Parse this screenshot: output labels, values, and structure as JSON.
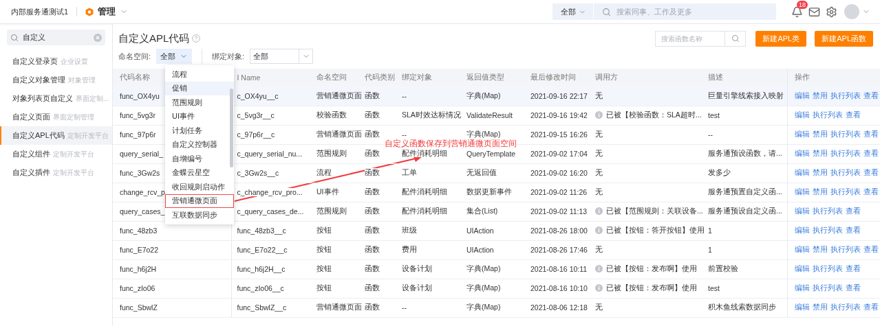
{
  "topbar": {
    "company": "内部服务通测试1",
    "app": "管理",
    "search": {
      "scope": "全部",
      "placeholder": "搜索同事、工作及更多"
    },
    "notifications": "18"
  },
  "sidebar": {
    "search": {
      "value": "自定义"
    },
    "items": [
      {
        "name": "自定义登录页",
        "section": "企业设置",
        "selected": false
      },
      {
        "name": "自定义对象管理",
        "section": "对象管理",
        "selected": false
      },
      {
        "name": "对象列表页自定义",
        "section": "界面定制...",
        "selected": false
      },
      {
        "name": "自定义页面",
        "section": "界面定制管理",
        "selected": false
      },
      {
        "name": "自定义APL代码",
        "section": "定制开发平台",
        "selected": true
      },
      {
        "name": "自定义组件",
        "section": "定制开发平台",
        "selected": false
      },
      {
        "name": "自定义插件",
        "section": "定制开发平台",
        "selected": false
      }
    ]
  },
  "page": {
    "title": "自定义APL代码",
    "search": {
      "placeholder": "搜索函数名称"
    },
    "buttons": [
      "新建APL类",
      "新建APL函数"
    ],
    "filters": [
      {
        "label": "命名空间:",
        "value": "全部",
        "open": true
      },
      {
        "label": "绑定对象:",
        "value": "全部",
        "open": false
      }
    ]
  },
  "dropdown": {
    "items": [
      {
        "label": "流程",
        "hovered": false,
        "outlined": false
      },
      {
        "label": "促销",
        "hovered": true,
        "outlined": false
      },
      {
        "label": "范围规则",
        "hovered": false,
        "outlined": false
      },
      {
        "label": "UI事件",
        "hovered": false,
        "outlined": false
      },
      {
        "label": "计划任务",
        "hovered": false,
        "outlined": false
      },
      {
        "label": "自定义控制器",
        "hovered": false,
        "outlined": false
      },
      {
        "label": "自增编号",
        "hovered": false,
        "outlined": false
      },
      {
        "label": "金蝶云星空",
        "hovered": false,
        "outlined": false
      },
      {
        "label": "收回规则启动作",
        "hovered": false,
        "outlined": false
      },
      {
        "label": "营销通微页面",
        "hovered": false,
        "outlined": true
      },
      {
        "label": "互联数据同步",
        "hovered": false,
        "outlined": false
      }
    ]
  },
  "annotation": {
    "text": "自定义函数保存到营销通微页面空间"
  },
  "table": {
    "columns": [
      "代码名称",
      "I Name",
      "命名空间",
      "代码类别",
      "绑定对象",
      "返回值类型",
      "最后修改时间",
      "调用方",
      "描述",
      "操作"
    ],
    "rows": [
      {
        "highlighted": true,
        "caller_used": false,
        "cells": [
          "func_OX4yu",
          "c_OX4yu__c",
          "营销通微页面",
          "函数",
          "--",
          "字典(Map)",
          "2021-09-16 22:17",
          "无",
          "巨量引擎线索接入映射"
        ],
        "actions": [
          "编辑",
          "禁用",
          "执行列表",
          "查看"
        ]
      },
      {
        "highlighted": false,
        "caller_used": true,
        "cells": [
          "func_5vg3r",
          "c_5vg3r__c",
          "校验函数",
          "函数",
          "SLA时效达标情况",
          "ValidateResult",
          "2021-09-16 19:42",
          "已被【校验函数：SLA超时...",
          "test"
        ],
        "actions": [
          "编辑",
          "执行列表",
          "查看"
        ]
      },
      {
        "highlighted": false,
        "caller_used": false,
        "cells": [
          "func_97p6r",
          "c_97p6r__c",
          "营销通微页面",
          "函数",
          "--",
          "字典(Map)",
          "2021-09-15 16:26",
          "无",
          "--"
        ],
        "actions": [
          "编辑",
          "禁用",
          "执行列表",
          "查看"
        ]
      },
      {
        "highlighted": false,
        "caller_used": false,
        "cells": [
          "query_serial_",
          "c_query_serial_nu...",
          "范围规则",
          "函数",
          "配件消耗明细",
          "QueryTemplate",
          "2021-09-02 17:04",
          "无",
          "服务通预设函数，请..."
        ],
        "actions": [
          "编辑",
          "禁用",
          "执行列表",
          "查看"
        ]
      },
      {
        "highlighted": false,
        "caller_used": false,
        "cells": [
          "func_3Gw2s",
          "c_3Gw2s__c",
          "流程",
          "函数",
          "工单",
          "无返回值",
          "2021-09-02 16:20",
          "无",
          "发多少"
        ],
        "actions": [
          "编辑",
          "禁用",
          "执行列表",
          "查看"
        ]
      },
      {
        "highlighted": false,
        "caller_used": false,
        "cells": [
          "change_rcv_p",
          "c_change_rcv_pro...",
          "UI事件",
          "函数",
          "配件消耗明细",
          "数据更新事件",
          "2021-09-02 11:26",
          "无",
          "服务通预置自定义函..."
        ],
        "actions": [
          "编辑",
          "禁用",
          "执行列表",
          "查看"
        ]
      },
      {
        "highlighted": false,
        "caller_used": true,
        "cells": [
          "query_cases_",
          "c_query_cases_de...",
          "范围规则",
          "函数",
          "配件消耗明细",
          "集合(List)",
          "2021-09-02 11:13",
          "已被【范围规则：关联设备...",
          "服务通预设自定义函..."
        ],
        "actions": [
          "编辑",
          "执行列表",
          "查看"
        ]
      },
      {
        "highlighted": false,
        "caller_used": true,
        "cells": [
          "func_48zb3",
          "func_48zb3__c",
          "按钮",
          "函数",
          "班级",
          "UIAction",
          "2021-08-26 18:00",
          "已被【按钮：答开按钮】使用",
          "1"
        ],
        "actions": [
          "编辑",
          "执行列表",
          "查看"
        ]
      },
      {
        "highlighted": false,
        "caller_used": false,
        "cells": [
          "func_E7o22",
          "func_E7o22__c",
          "按钮",
          "函数",
          "费用",
          "UIAction",
          "2021-08-26 17:46",
          "无",
          "1"
        ],
        "actions": [
          "编辑",
          "禁用",
          "执行列表",
          "查看"
        ]
      },
      {
        "highlighted": false,
        "caller_used": true,
        "cells": [
          "func_h6j2H",
          "func_h6j2H__c",
          "按钮",
          "函数",
          "设备计划",
          "字典(Map)",
          "2021-08-16 10:11",
          "已被【按钮：发布啊】使用",
          "前置校验"
        ],
        "actions": [
          "编辑",
          "执行列表",
          "查看"
        ]
      },
      {
        "highlighted": false,
        "caller_used": true,
        "cells": [
          "func_zIo06",
          "func_zIo06__c",
          "按钮",
          "函数",
          "设备计划",
          "字典(Map)",
          "2021-08-16 10:10",
          "已被【按钮：发布啊】使用",
          "test"
        ],
        "actions": [
          "编辑",
          "执行列表",
          "查看"
        ]
      },
      {
        "highlighted": false,
        "caller_used": false,
        "cells": [
          "func_SbwlZ",
          "func_SbwlZ__c",
          "营销通微页面",
          "函数",
          "--",
          "字典(Map)",
          "2021-08-06 12:18",
          "无",
          "积木鱼线索数据同步"
        ],
        "actions": [
          "编辑",
          "禁用",
          "执行列表",
          "查看"
        ]
      }
    ]
  }
}
